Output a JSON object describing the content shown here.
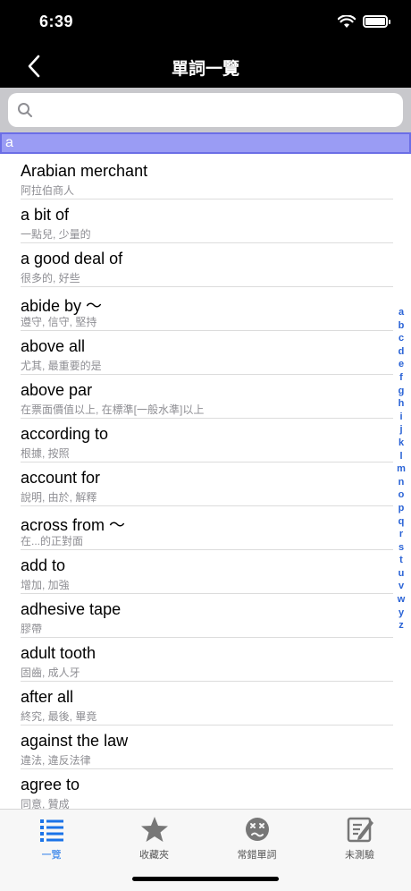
{
  "status": {
    "time": "6:39"
  },
  "nav": {
    "title": "單詞一覽"
  },
  "search": {
    "placeholder": "",
    "value": ""
  },
  "section": {
    "header": "a"
  },
  "list": [
    {
      "word": "Arabian merchant",
      "meaning": "阿拉伯商人"
    },
    {
      "word": "a bit of",
      "meaning": "一點兒, 少量的"
    },
    {
      "word": "a good deal of",
      "meaning": "很多的, 好些"
    },
    {
      "word": "abide by ～",
      "meaning": "遵守, 信守, 堅持"
    },
    {
      "word": "above all",
      "meaning": "尤其, 最重要的是"
    },
    {
      "word": "above par",
      "meaning": "在票面價值以上, 在標準[一般水準]以上"
    },
    {
      "word": "according to",
      "meaning": "根據, 按照"
    },
    {
      "word": "account for",
      "meaning": "說明, 由於, 解釋"
    },
    {
      "word": "across from ～",
      "meaning": "在...的正對面"
    },
    {
      "word": "add to",
      "meaning": "增加, 加強"
    },
    {
      "word": "adhesive tape",
      "meaning": "膠帶"
    },
    {
      "word": "adult tooth",
      "meaning": "固齒, 成人牙"
    },
    {
      "word": "after all",
      "meaning": "終究, 最後, 畢竟"
    },
    {
      "word": "against the law",
      "meaning": "違法, 違反法律"
    },
    {
      "word": "agree to",
      "meaning": "同意, 贊成"
    }
  ],
  "index": [
    "a",
    "b",
    "c",
    "d",
    "e",
    "f",
    "g",
    "h",
    "i",
    "j",
    "k",
    "l",
    "m",
    "n",
    "o",
    "p",
    "q",
    "r",
    "s",
    "t",
    "u",
    "v",
    "w",
    "y",
    "z"
  ],
  "tabs": [
    {
      "label": "一覽",
      "icon": "list-icon",
      "active": true
    },
    {
      "label": "收藏夾",
      "icon": "star-icon",
      "active": false
    },
    {
      "label": "常錯單詞",
      "icon": "mistake-face-icon",
      "active": false
    },
    {
      "label": "未測驗",
      "icon": "quiz-icon",
      "active": false
    }
  ],
  "colors": {
    "accent": "#1b73e8",
    "section_header": "#9a9cf4",
    "index": "#2a63d6"
  }
}
